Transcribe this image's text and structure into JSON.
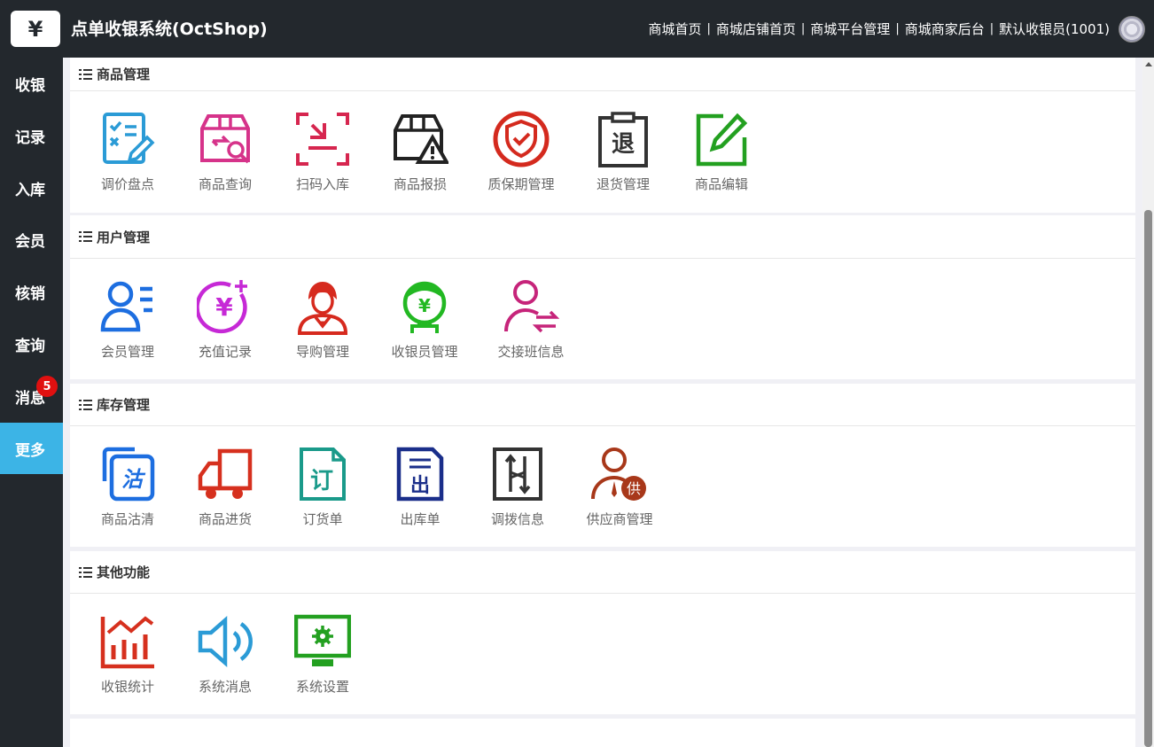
{
  "header": {
    "logo_symbol": "¥",
    "title": "点单收银系统(OctShop)",
    "nav": [
      "商城首页",
      "商城店铺首页",
      "商城平台管理",
      "商城商家后台",
      "默认收银员(1001)"
    ],
    "separator": "|"
  },
  "sidebar": {
    "items": [
      {
        "label": "收银"
      },
      {
        "label": "记录"
      },
      {
        "label": "入库"
      },
      {
        "label": "会员"
      },
      {
        "label": "核销"
      },
      {
        "label": "查询"
      },
      {
        "label": "消息",
        "badge": "5"
      },
      {
        "label": "更多",
        "active": true
      }
    ]
  },
  "sections": [
    {
      "title": "商品管理",
      "items": [
        {
          "label": "调价盘点",
          "icon": "checklist-pencil-icon",
          "color": "#2b9bd6"
        },
        {
          "label": "商品查询",
          "icon": "box-search-icon",
          "color": "#d6338a"
        },
        {
          "label": "扫码入库",
          "icon": "scan-download-icon",
          "color": "#d6264f"
        },
        {
          "label": "商品报损",
          "icon": "box-warning-icon",
          "color": "#222222"
        },
        {
          "label": "质保期管理",
          "icon": "shield-check-icon",
          "color": "#d42a1e"
        },
        {
          "label": "退货管理",
          "icon": "clipboard-return-icon",
          "color": "#333333",
          "glyph": "退"
        },
        {
          "label": "商品编辑",
          "icon": "edit-square-icon",
          "color": "#23a020"
        }
      ]
    },
    {
      "title": "用户管理",
      "items": [
        {
          "label": "会员管理",
          "icon": "member-list-icon",
          "color": "#1d6ee0"
        },
        {
          "label": "充值记录",
          "icon": "yen-plus-icon",
          "color": "#c629d6",
          "glyph": "¥"
        },
        {
          "label": "导购管理",
          "icon": "shopping-guide-icon",
          "color": "#d62a1e"
        },
        {
          "label": "收银员管理",
          "icon": "cashier-icon",
          "color": "#22b822",
          "glyph": "¥"
        },
        {
          "label": "交接班信息",
          "icon": "user-exchange-icon",
          "color": "#c6247a"
        }
      ]
    },
    {
      "title": "库存管理",
      "items": [
        {
          "label": "商品沽清",
          "icon": "sold-out-icon",
          "color": "#1d6ee0",
          "glyph": "沽"
        },
        {
          "label": "商品进货",
          "icon": "truck-icon",
          "color": "#d6301e"
        },
        {
          "label": "订货单",
          "icon": "order-doc-icon",
          "color": "#1a9a8a",
          "glyph": "订"
        },
        {
          "label": "出库单",
          "icon": "outbound-doc-icon",
          "color": "#1a2e8a",
          "glyph": "出"
        },
        {
          "label": "调拨信息",
          "icon": "transfer-icon",
          "color": "#333333"
        },
        {
          "label": "供应商管理",
          "icon": "supplier-icon",
          "color": "#a8381a",
          "glyph": "供"
        }
      ]
    },
    {
      "title": "其他功能",
      "items": [
        {
          "label": "收银统计",
          "icon": "bar-stats-icon",
          "color": "#d6301e"
        },
        {
          "label": "系统消息",
          "icon": "speaker-icon",
          "color": "#2b9bd6"
        },
        {
          "label": "系统设置",
          "icon": "monitor-settings-icon",
          "color": "#23a020"
        }
      ]
    }
  ]
}
